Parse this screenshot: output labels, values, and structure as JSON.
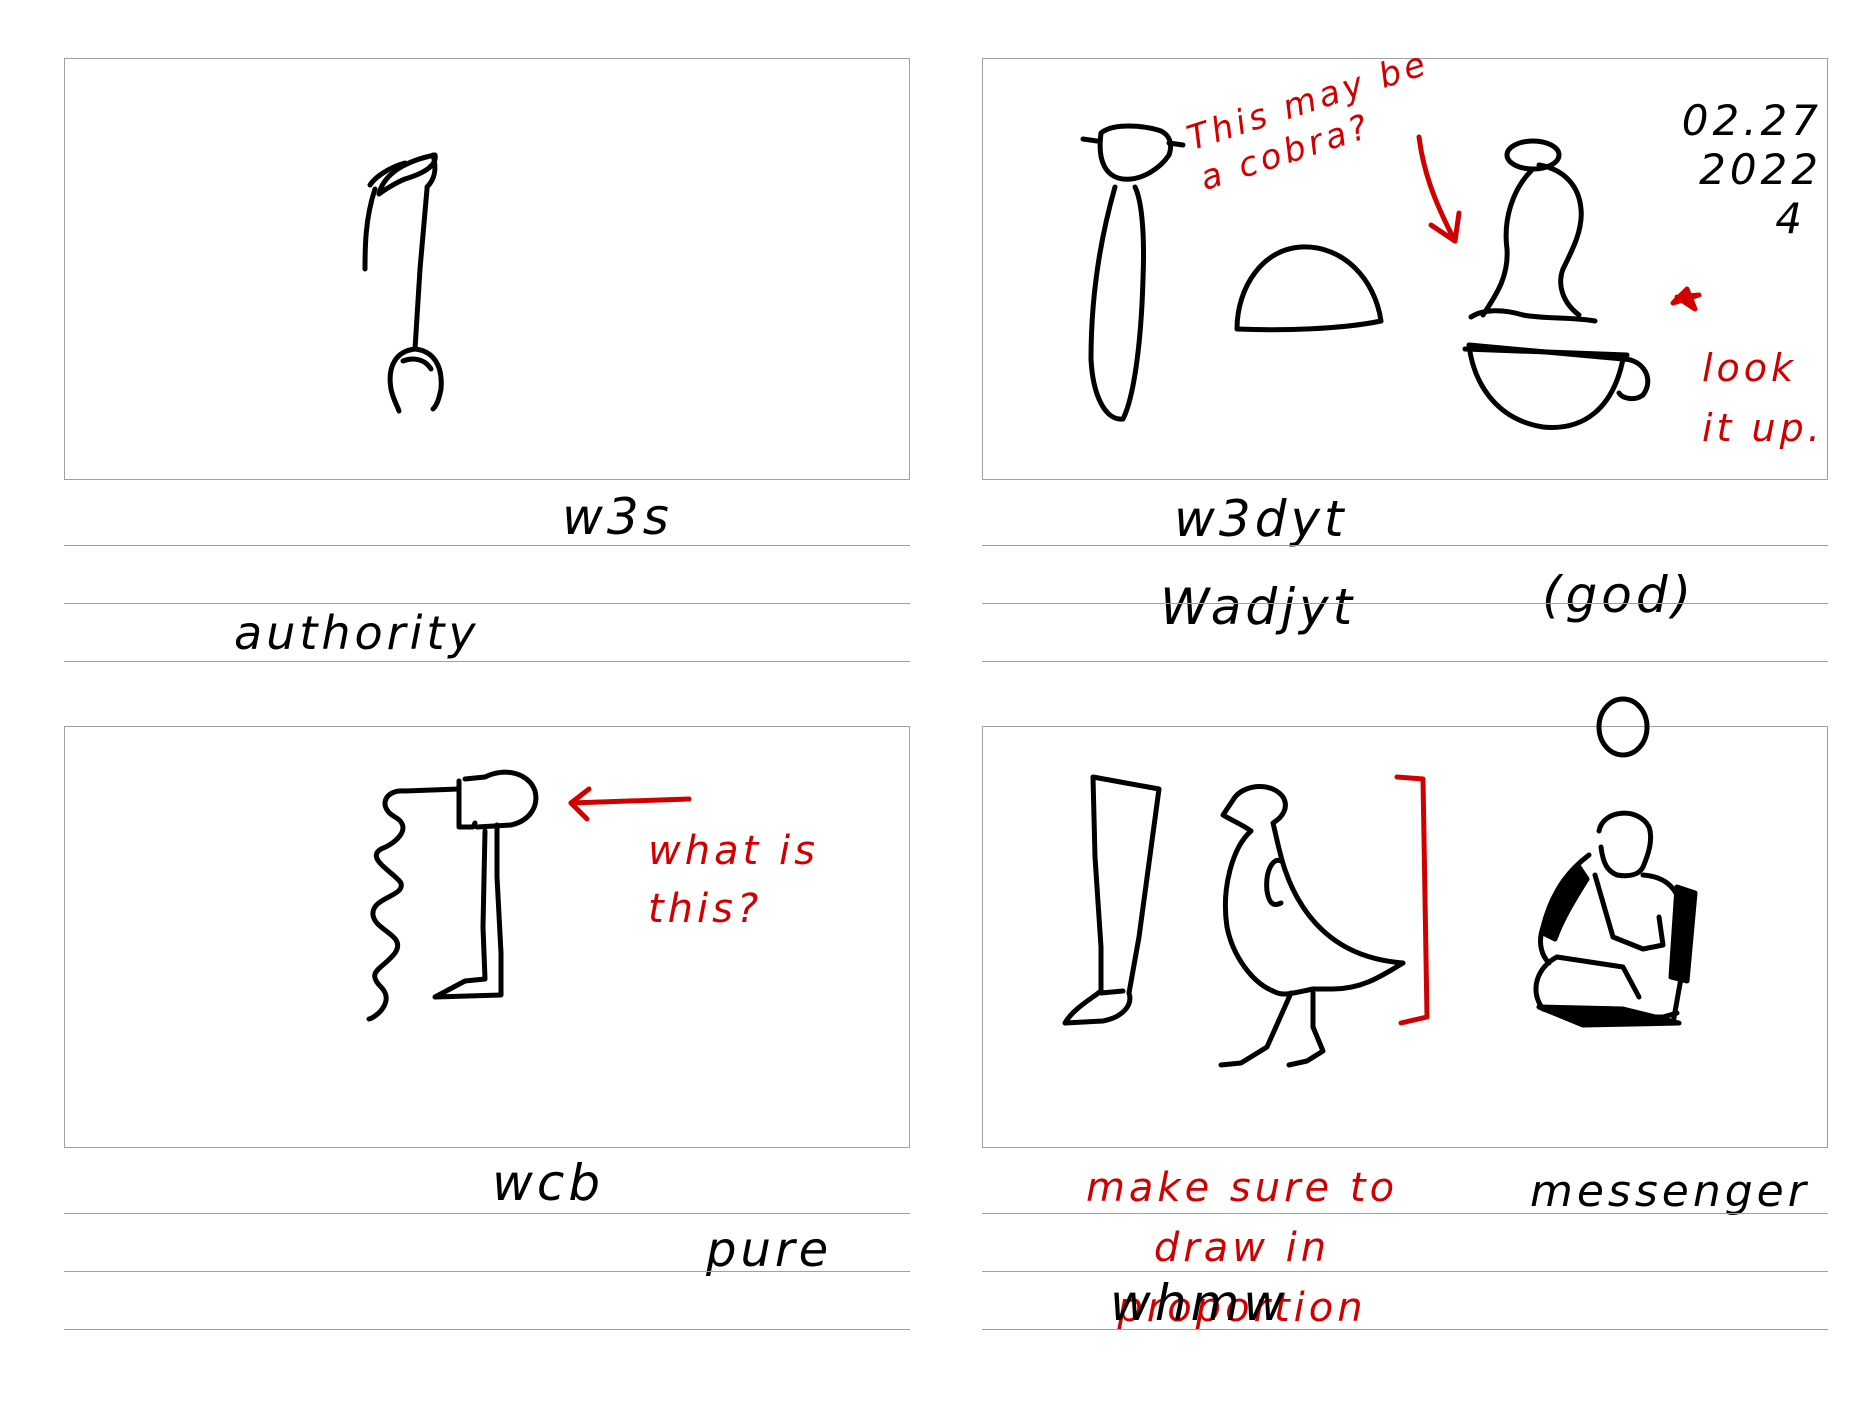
{
  "cards": [
    {
      "transliteration": "w3s",
      "meaning": "authority",
      "glyph_icon": "was-scepter-icon"
    },
    {
      "transliteration": "w3dyt",
      "meaning": "Wadjyt",
      "meaning_note": "(god)",
      "glyph_icon": "wadjet-cobra-basket-icon",
      "note": "This may be a cobra?",
      "date": [
        "02.27",
        "2022",
        "4"
      ],
      "reminder": "look it up."
    },
    {
      "transliteration": "wcb",
      "meaning": "pure",
      "glyph_icon": "water-jar-leg-icon",
      "note": "what is this?"
    },
    {
      "transliteration": "whmw",
      "meaning": "messenger",
      "glyph_icon": "leg-quail-chick-seated-man-icon",
      "note": "make sure to draw in proportion"
    }
  ],
  "colors": {
    "ink": "#000000",
    "annotation": "#d00000",
    "rule": "#a0a0a0"
  }
}
